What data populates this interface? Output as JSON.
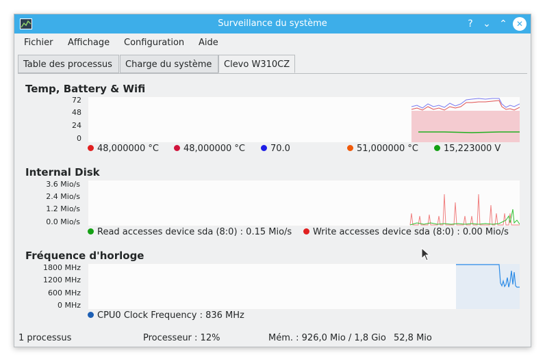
{
  "window": {
    "title": "Surveillance du système"
  },
  "titlebar_buttons": {
    "help": "?",
    "minimize": "⌄",
    "maximize": "⌃",
    "close": "✕"
  },
  "menu": [
    "Fichier",
    "Affichage",
    "Configuration",
    "Aide"
  ],
  "tabs": [
    "Table des processus",
    "Charge du système",
    "Clevo W310CZ"
  ],
  "sensors": {
    "title": "Temp, Battery & Wifi",
    "yticks": [
      "72",
      "48",
      "24",
      "0"
    ],
    "legend": [
      {
        "label": "48,000000 °C",
        "color": "#e02020"
      },
      {
        "label": "48,000000 °C",
        "color": "#d0143c"
      },
      {
        "label": "70.0",
        "color": "#1e1ee6"
      },
      {
        "label": "51,000000 °C",
        "color": "#f05a0a"
      },
      {
        "label": "15,223000 V",
        "color": "#14a014"
      }
    ]
  },
  "disk": {
    "title": "Internal Disk",
    "yticks": [
      "3.6 Mio/s",
      "2.4 Mio/s",
      "1.2 Mio/s",
      "0.0 Mio/s"
    ],
    "legend": [
      {
        "label": "Read accesses device sda (8:0) : 0.15 Mio/s",
        "color": "#14a014"
      },
      {
        "label": "Write accesses device sda (8:0) : 0.00 Mio/s",
        "color": "#e02020"
      }
    ]
  },
  "clock": {
    "title": "Fréquence d'horloge",
    "yticks": [
      "1800 MHz",
      "1200 MHz",
      "600 MHz",
      "0 MHz"
    ],
    "legend": [
      {
        "label": "CPU0 Clock Frequency : 836 MHz",
        "color": "#1d5fb4"
      }
    ]
  },
  "status": {
    "processes": "1 processus",
    "cpu": "Processeur : 12%",
    "memory": "Mém. : 926,0 Mio / 1,8 Gio",
    "swap": "52,8 Mio"
  }
}
